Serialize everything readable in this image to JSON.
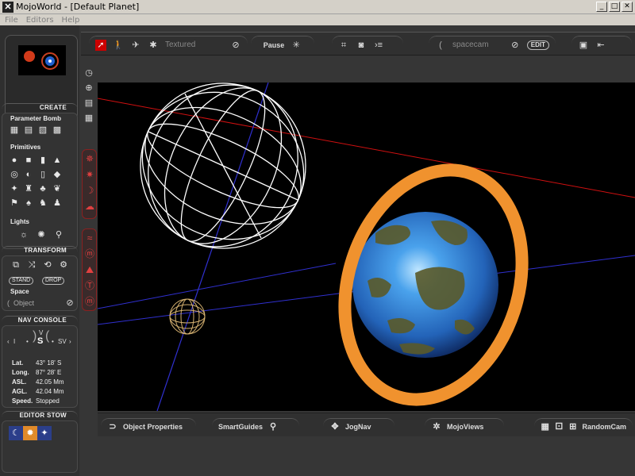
{
  "window": {
    "title": "MojoWorld - [Default Planet]",
    "app_icon": "mojo-x-logo",
    "buttons": {
      "minimize": "_",
      "maximize": "□",
      "close": "✕"
    }
  },
  "menu": [
    "File",
    "Editors",
    "Help"
  ],
  "toolbar": {
    "render_mode_value": "Textured",
    "pause_label": "Pause",
    "camera_value": "spacecam",
    "edit_label": "EDIT"
  },
  "left_panel": {
    "create": {
      "title": "CREATE",
      "parameter_bomb_label": "Parameter Bomb",
      "primitives_label": "Primitives",
      "lights_label": "Lights"
    },
    "transform": {
      "title": "TRANSFORM",
      "stand_label": "STAND",
      "drop_label": "DROP",
      "space_label": "Space",
      "space_value": "Object"
    },
    "nav_console": {
      "title": "NAV CONSOLE",
      "compass": {
        "north": "V",
        "heading": "S",
        "left": "I",
        "right": "SV"
      },
      "rows": [
        {
          "key": "Lat.",
          "value": "43° 18' S"
        },
        {
          "key": "Long.",
          "value": "87° 28' E"
        },
        {
          "key": "ASL.",
          "value": "42.05 Mm"
        },
        {
          "key": "AGL.",
          "value": "42.04 Mm"
        },
        {
          "key": "Speed.",
          "value": "Stopped"
        }
      ]
    },
    "editor_stow": {
      "title": "EDITOR STOW"
    }
  },
  "bottom_tabs": {
    "object_properties": "Object Properties",
    "smartguides": "SmartGuides",
    "jognav": "JogNav",
    "mojoviews": "MojoViews",
    "randomcam": "RandomCam"
  },
  "colors": {
    "accent_red": "#cc0000",
    "ring_orange": "#f0922e",
    "planet_blue": "#2f7fd6",
    "axis_red": "#d01010",
    "axis_blue": "#3030d0"
  }
}
